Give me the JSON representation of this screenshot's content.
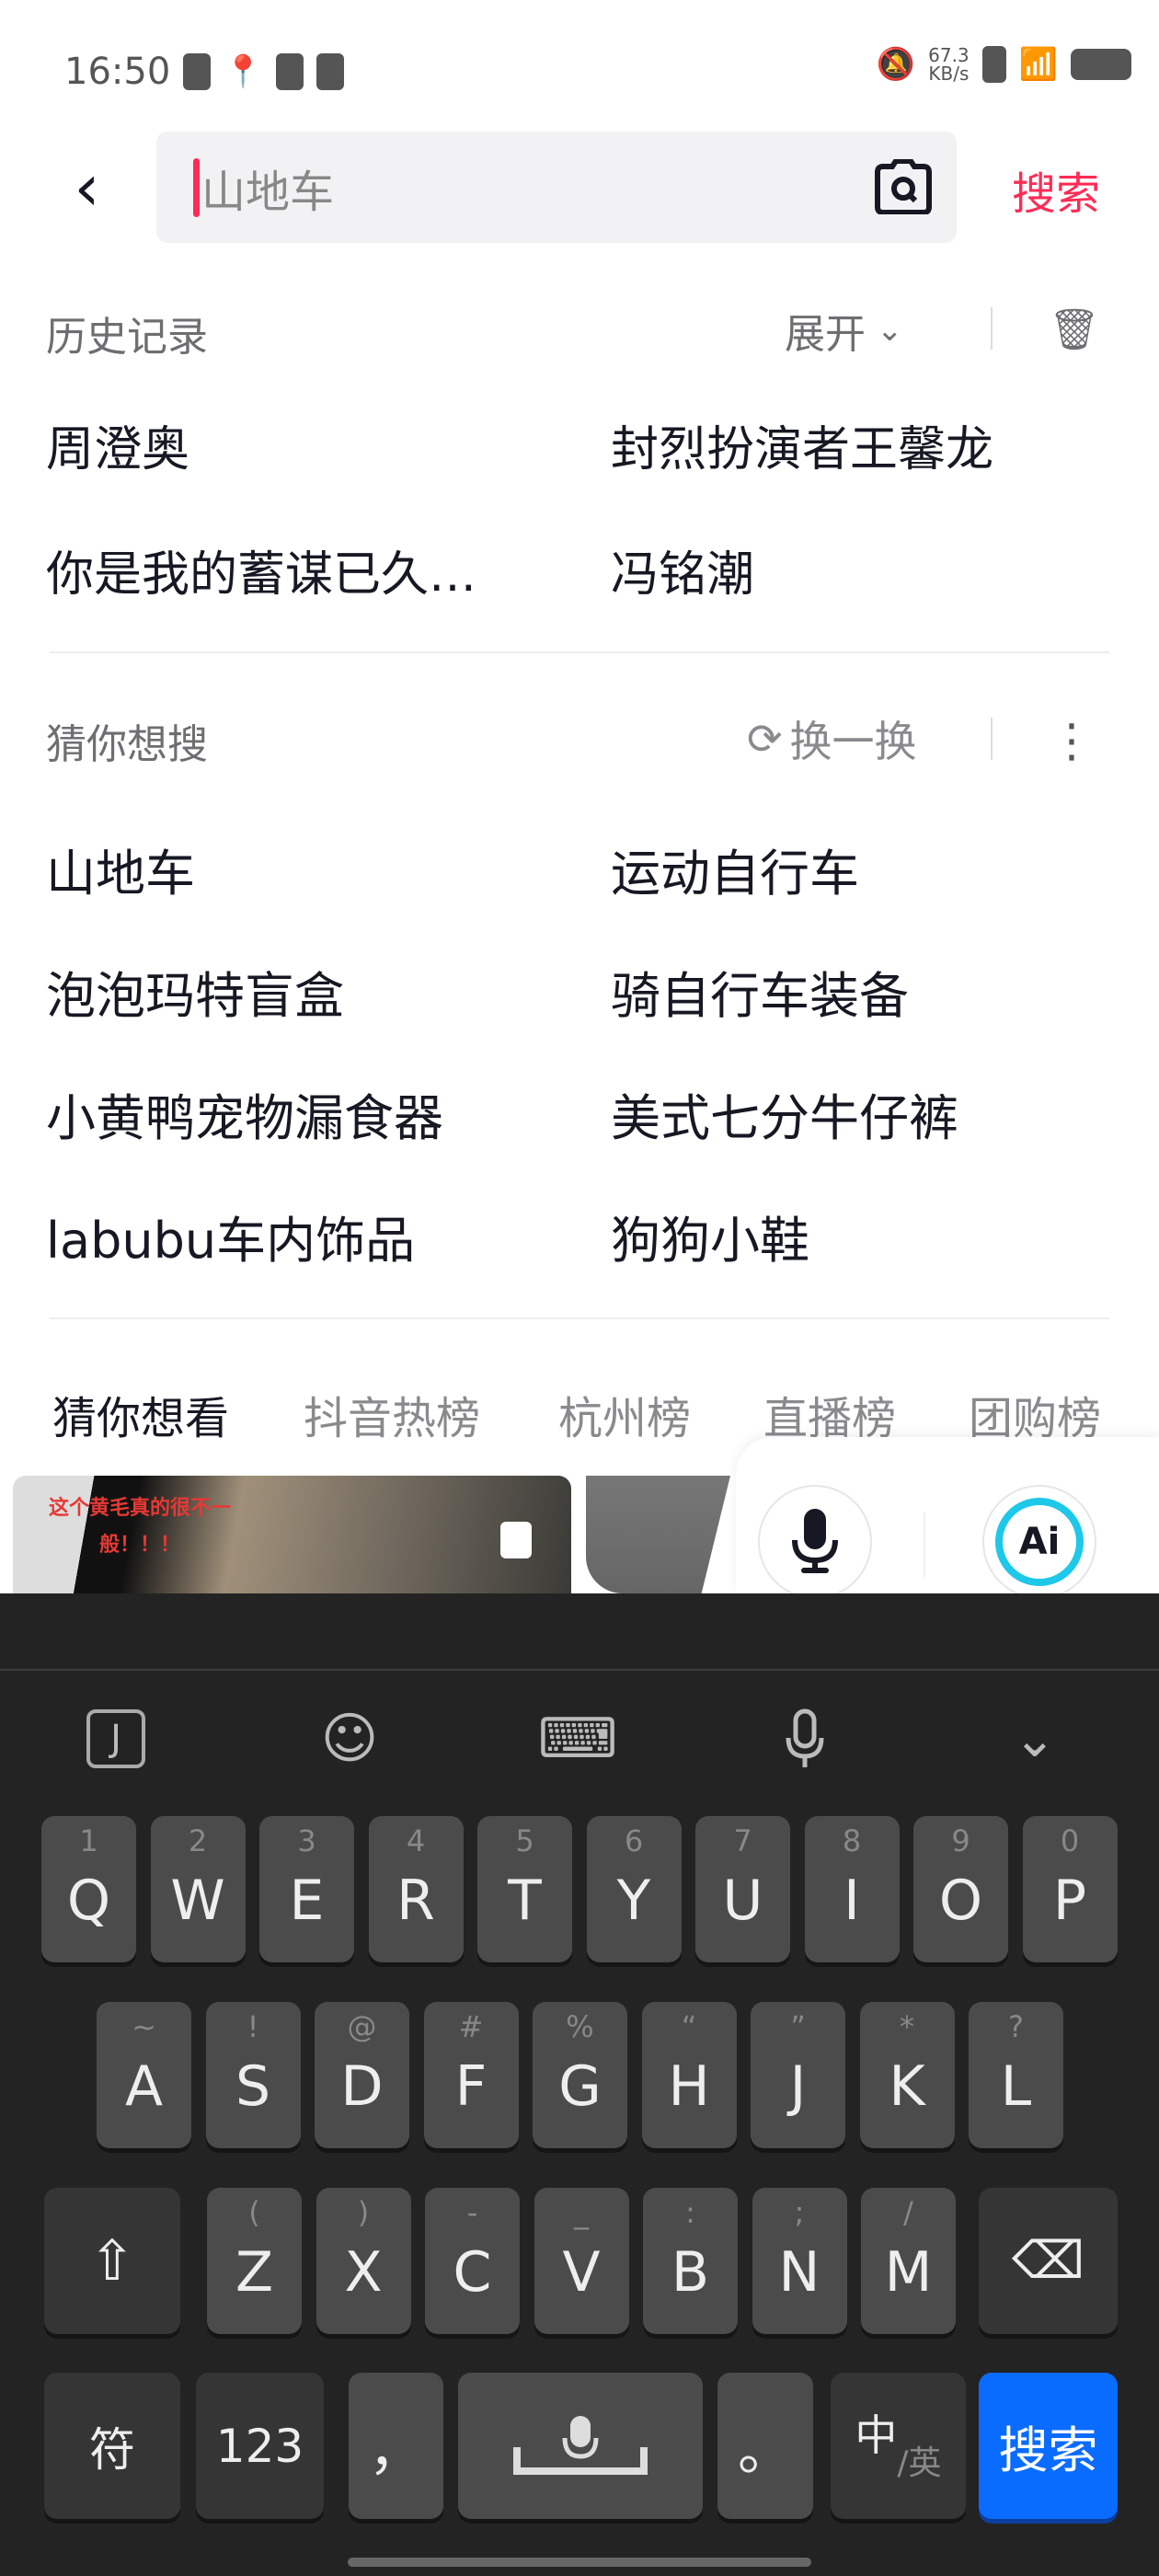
{
  "status_bar": {
    "time": "16:50",
    "speed": "67.3",
    "speed_unit": "KB/s"
  },
  "search": {
    "query": "山地车",
    "button": "搜索"
  },
  "history": {
    "title": "历史记录",
    "expand": "展开",
    "items": [
      "周澄奥",
      "封烈扮演者王馨龙",
      "你是我的蓄谋已久…",
      "冯铭潮"
    ]
  },
  "guess": {
    "title": "猜你想搜",
    "refresh": "换一换",
    "items": [
      "山地车",
      "运动自行车",
      "泡泡玛特盲盒",
      "骑自行车装备",
      "小黄鸭宠物漏食器",
      "美式七分牛仔裤",
      "labubu车内饰品",
      "狗狗小鞋"
    ]
  },
  "tabs": [
    "猜你想看",
    "抖音热榜",
    "杭州榜",
    "直播榜",
    "团购榜"
  ],
  "video": {
    "caption": "这个黄毛真的很不一般！！！"
  },
  "ai_label": "Ai",
  "keyboard": {
    "row1": [
      [
        "Q",
        "1"
      ],
      [
        "W",
        "2"
      ],
      [
        "E",
        "3"
      ],
      [
        "R",
        "4"
      ],
      [
        "T",
        "5"
      ],
      [
        "Y",
        "6"
      ],
      [
        "U",
        "7"
      ],
      [
        "I",
        "8"
      ],
      [
        "O",
        "9"
      ],
      [
        "P",
        "0"
      ]
    ],
    "row2": [
      [
        "A",
        "~"
      ],
      [
        "S",
        "!"
      ],
      [
        "D",
        "@"
      ],
      [
        "F",
        "#"
      ],
      [
        "G",
        "%"
      ],
      [
        "H",
        "“"
      ],
      [
        "J",
        "”"
      ],
      [
        "K",
        "*"
      ],
      [
        "L",
        "?"
      ]
    ],
    "row3": [
      [
        "Z",
        "("
      ],
      [
        "X",
        ")"
      ],
      [
        "C",
        "-"
      ],
      [
        "V",
        "_"
      ],
      [
        "B",
        ":"
      ],
      [
        "N",
        ";"
      ],
      [
        "M",
        "/"
      ]
    ],
    "symbols": "符",
    "numbers": "123",
    "comma": "，",
    "period": "。",
    "lang_main": "中",
    "lang_sub": "/英",
    "enter": "搜索"
  },
  "colors": {
    "accent": "#fe2c55",
    "enter": "#0a6cff",
    "keyboard_bg": "#232323"
  }
}
